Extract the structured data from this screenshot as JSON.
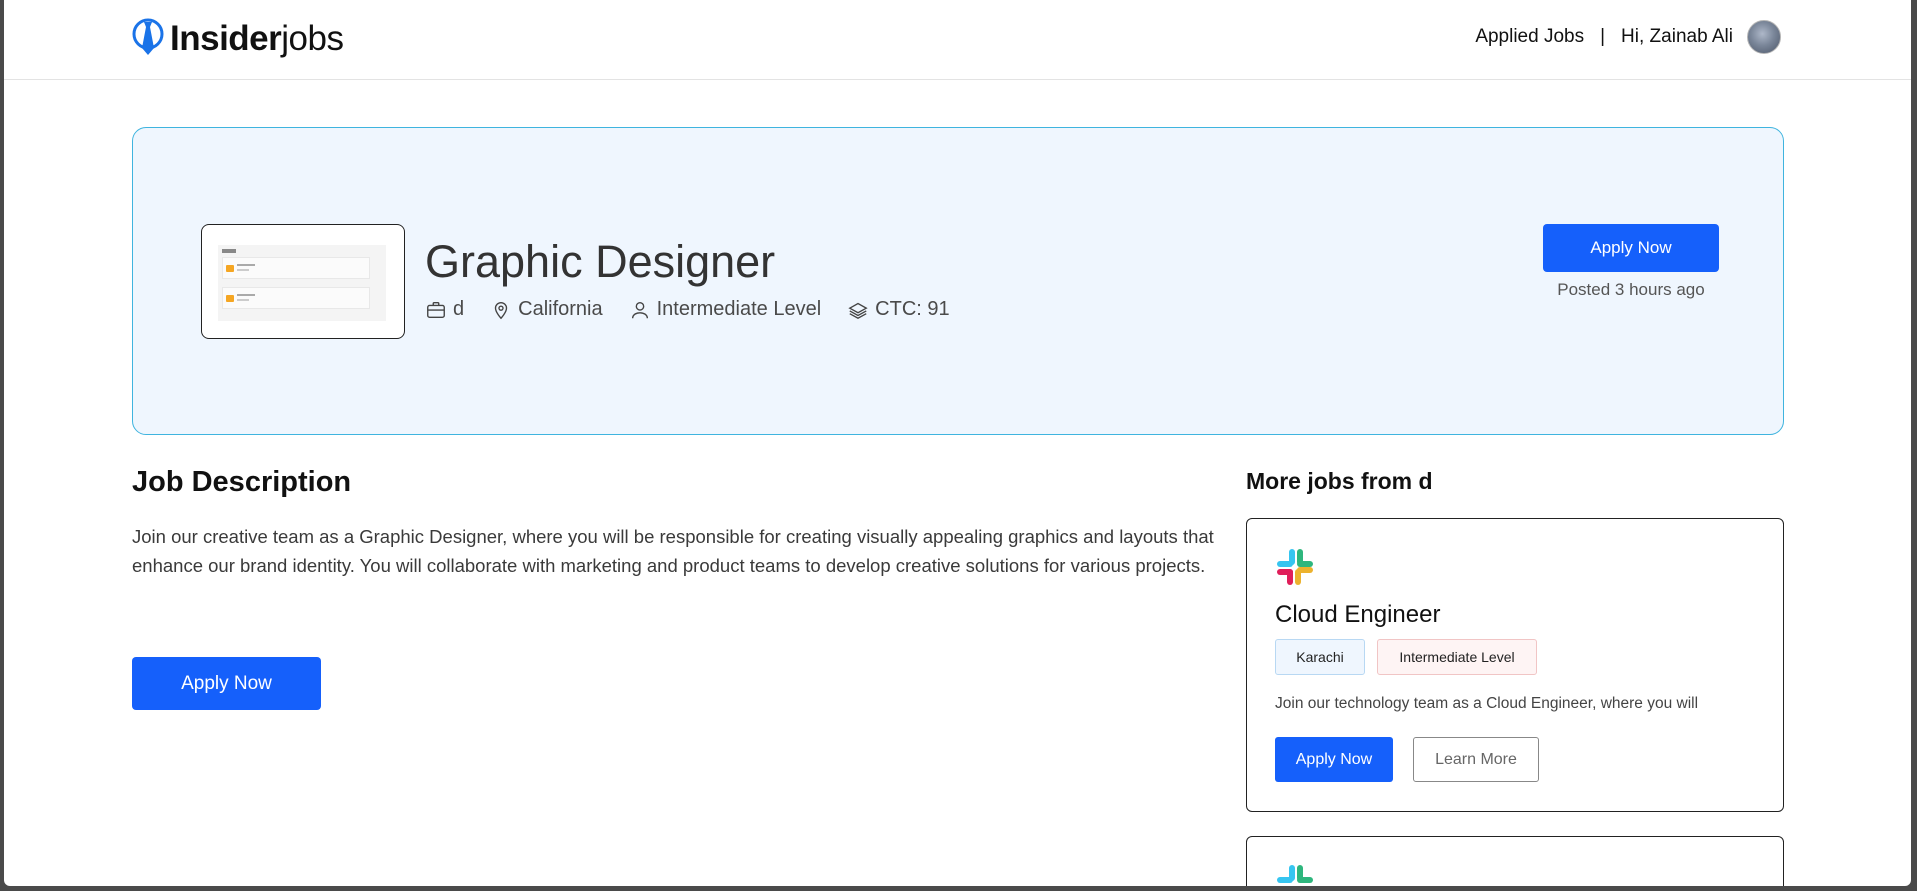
{
  "navbar": {
    "logo_bold": "Insider",
    "logo_light": "jobs",
    "applied_jobs": "Applied Jobs",
    "separator": "|",
    "greeting": "Hi, Zainab Ali"
  },
  "job": {
    "title": "Graphic Designer",
    "company": "d",
    "location": "California",
    "level": "Intermediate Level",
    "ctc": "CTC: 91",
    "apply_label": "Apply Now",
    "posted": "Posted 3 hours ago"
  },
  "description": {
    "heading": "Job Description",
    "text": "Join our creative team as a Graphic Designer, where you will be responsible for creating visually appealing graphics and layouts that enhance our brand identity. You will collaborate with marketing and product teams to develop creative solutions for various projects.",
    "apply_label": "Apply Now"
  },
  "more_jobs": {
    "heading": "More jobs from d",
    "cards": [
      {
        "title": "Cloud Engineer",
        "location": "Karachi",
        "level": "Intermediate Level",
        "desc": "Join our technology team as a Cloud Engineer, where you will",
        "apply_label": "Apply Now",
        "learn_label": "Learn More",
        "logo_icon": "slack-icon"
      },
      {
        "logo_icon": "slack-icon"
      }
    ]
  },
  "colors": {
    "primary": "#1560fb",
    "hero_bg": "#eff6fe",
    "hero_border": "#3fb4df",
    "logo_blue": "#1a73e8"
  }
}
